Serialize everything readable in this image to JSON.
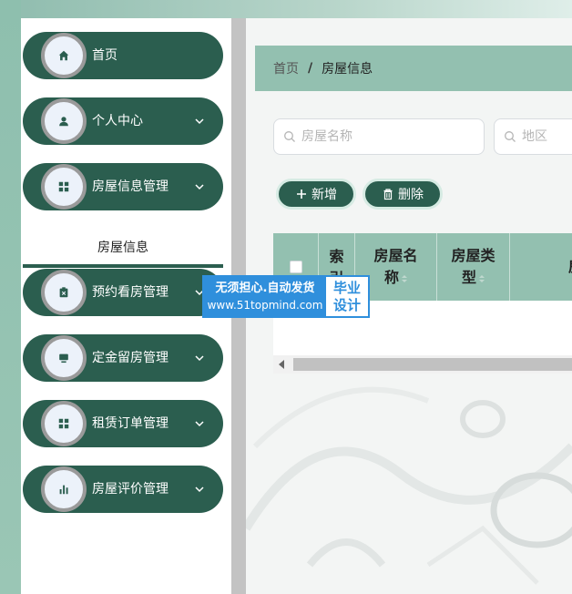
{
  "sidebar": {
    "items": [
      {
        "label": "首页",
        "icon": "home-icon"
      },
      {
        "label": "个人中心",
        "icon": "user-icon"
      },
      {
        "label": "房屋信息管理",
        "icon": "grid-icon"
      },
      {
        "label": "预约看房管理",
        "icon": "clipboard-icon"
      },
      {
        "label": "定金留房管理",
        "icon": "monitor-icon"
      },
      {
        "label": "租赁订单管理",
        "icon": "grid-icon"
      },
      {
        "label": "房屋评价管理",
        "icon": "bar-chart-icon"
      }
    ],
    "active_submenu": "房屋信息"
  },
  "breadcrumb": {
    "home": "首页",
    "separator": "/",
    "current": "房屋信息"
  },
  "search": {
    "house_name_placeholder": "房屋名称",
    "region_placeholder": "地区"
  },
  "toolbar": {
    "add_label": "新增",
    "delete_label": "删除"
  },
  "table": {
    "columns": [
      "索引",
      "房屋名称",
      "房屋类型",
      "房"
    ]
  },
  "watermark": {
    "line1": "无须担心.自动发货",
    "line2": "www.51topmind.com",
    "right_line1": "毕业",
    "right_line2": "设计"
  },
  "colors": {
    "primary": "#2b5e4f",
    "accent_light": "#93c0b0",
    "watermark_blue": "#2f8fdc"
  }
}
